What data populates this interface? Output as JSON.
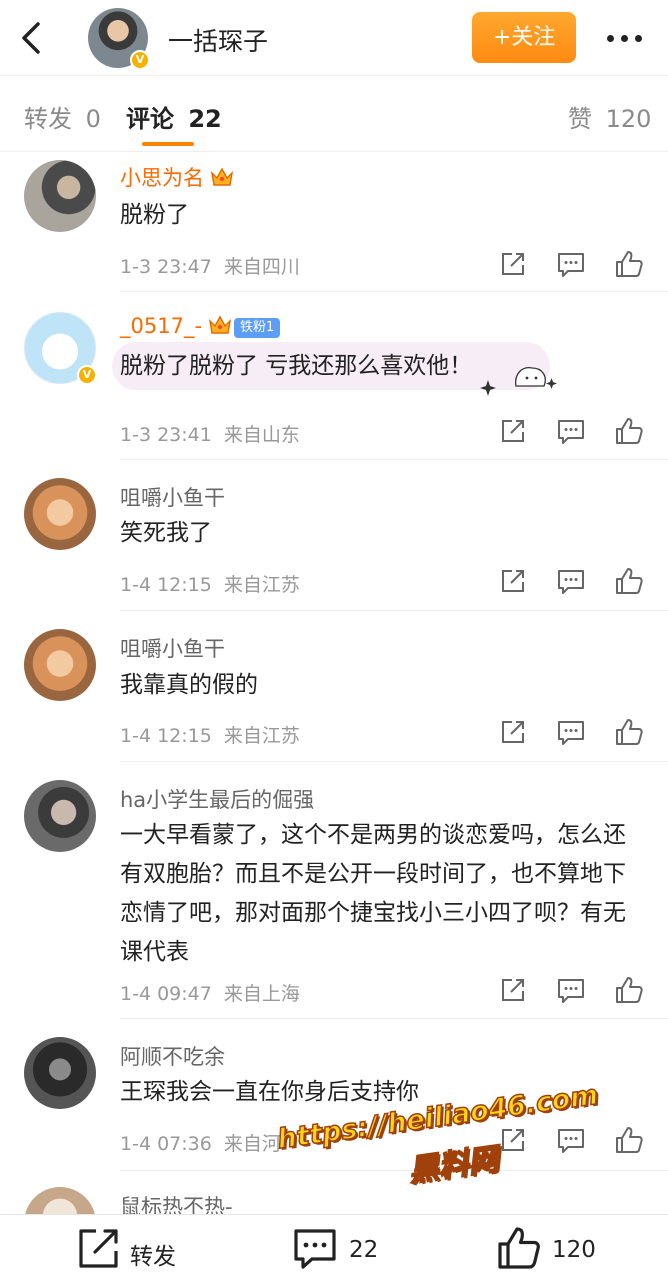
{
  "header": {
    "account_name": "一括琛子",
    "follow_label": "+关注"
  },
  "tabs": [
    {
      "label": "转发",
      "count": "0"
    },
    {
      "label": "评论",
      "count": "22"
    },
    {
      "label": "赞",
      "count": "120"
    }
  ],
  "comments": [
    {
      "name": "小思为名",
      "text": "脱粉了",
      "time": "1-3 23:47",
      "location": "来自四川"
    },
    {
      "name": "_0517_-",
      "fan_badge": "铁粉1",
      "text": "脱粉了脱粉了 亏我还那么喜欢他！",
      "time": "1-3 23:41",
      "location": "来自山东"
    },
    {
      "name": "咀嚼小鱼干",
      "text": "笑死我了",
      "time": "1-4 12:15",
      "location": "来自江苏"
    },
    {
      "name": "咀嚼小鱼干",
      "text": "我靠真的假的",
      "time": "1-4 12:15",
      "location": "来自江苏"
    },
    {
      "name": "ha小学生最后的倔强",
      "text": "一大早看蒙了，这个不是两男的谈恋爱吗，怎么还有双胞胎？而且不是公开一段时间了，也不算地下恋情了吧，那对面那个捷宝找小三小四了呗？有无课代表",
      "time": "1-4 09:47",
      "location": "来自上海"
    },
    {
      "name": "阿顺不吃余",
      "text": "王琛我会一直在你身后支持你",
      "time": "1-4 07:36",
      "location": "来自河"
    },
    {
      "name": "鼠标热不热-"
    }
  ],
  "watermark": {
    "line1": "https://heiliao46.com",
    "line2": "黑料网"
  },
  "bottom_bar": {
    "repost_label": "转发",
    "comment_count": "22",
    "like_count": "120"
  },
  "colors": {
    "accent": "#ff8200",
    "name_vip": "#ff6a00",
    "fan_badge": "#5c9ef7",
    "verified": "#f7b100"
  }
}
